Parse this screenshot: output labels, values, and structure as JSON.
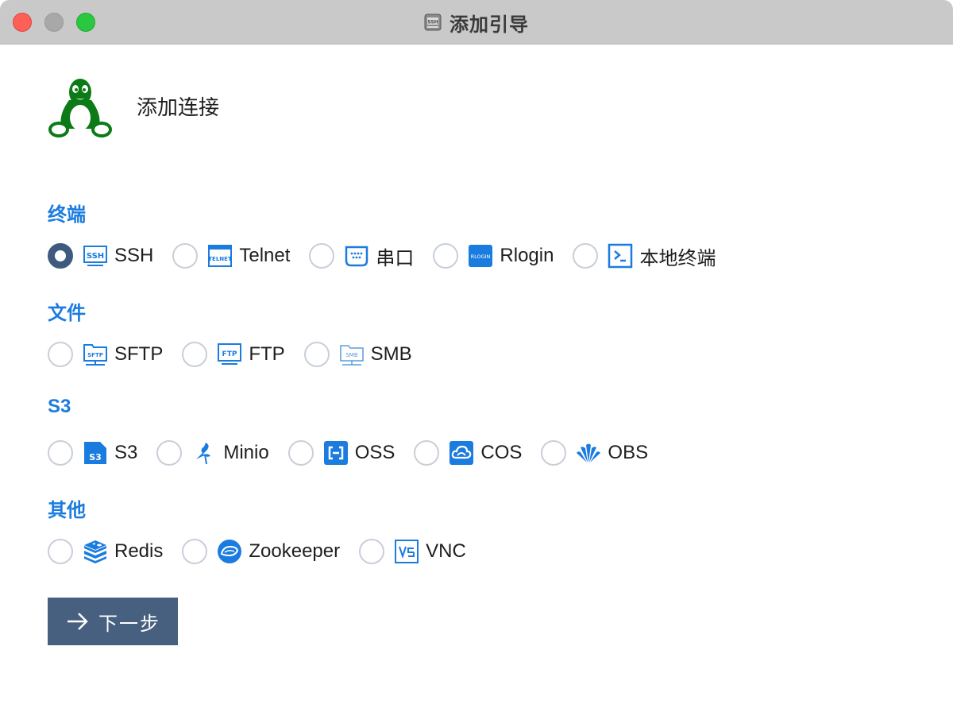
{
  "window": {
    "title": "添加引导",
    "title_icon": "ssh-icon"
  },
  "header": {
    "title": "添加连接",
    "logo": "tux-icon"
  },
  "sections": [
    {
      "title": "终端",
      "options": [
        {
          "label": "SSH",
          "icon": "ssh-icon",
          "checked": true
        },
        {
          "label": "Telnet",
          "icon": "telnet-icon",
          "checked": false
        },
        {
          "label": "串口",
          "icon": "serial-icon",
          "checked": false
        },
        {
          "label": "Rlogin",
          "icon": "rlogin-icon",
          "checked": false
        },
        {
          "label": "本地终端",
          "icon": "terminal-icon",
          "checked": false
        }
      ]
    },
    {
      "title": "文件",
      "options": [
        {
          "label": "SFTP",
          "icon": "sftp-icon",
          "checked": false
        },
        {
          "label": "FTP",
          "icon": "ftp-icon",
          "checked": false
        },
        {
          "label": "SMB",
          "icon": "smb-icon",
          "checked": false
        }
      ]
    },
    {
      "title": "S3",
      "options": [
        {
          "label": "S3",
          "icon": "s3-icon",
          "checked": false
        },
        {
          "label": "Minio",
          "icon": "minio-icon",
          "checked": false
        },
        {
          "label": "OSS",
          "icon": "oss-icon",
          "checked": false
        },
        {
          "label": "COS",
          "icon": "cos-icon",
          "checked": false
        },
        {
          "label": "OBS",
          "icon": "obs-icon",
          "checked": false
        }
      ]
    },
    {
      "title": "其他",
      "options": [
        {
          "label": "Redis",
          "icon": "redis-icon",
          "checked": false
        },
        {
          "label": "Zookeeper",
          "icon": "zookeeper-icon",
          "checked": false
        },
        {
          "label": "VNC",
          "icon": "vnc-icon",
          "checked": false
        }
      ]
    }
  ],
  "next_button": {
    "label": "下一步",
    "icon": "arrow-right-icon"
  },
  "colors": {
    "accent": "#1b7cdf",
    "button": "#47607f",
    "radio_checked": "#3f5a7f",
    "tux": "#0b7a17"
  }
}
